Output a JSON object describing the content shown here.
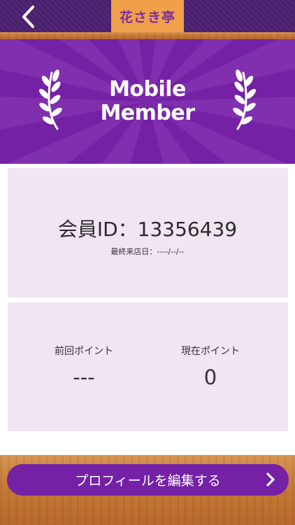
{
  "header": {
    "title": "花さき亭",
    "back_icon": "chevron-left-icon"
  },
  "banner": {
    "line1": "Mobile",
    "line2": "Member",
    "decoration_icon": "laurel-icon"
  },
  "member": {
    "id_text": "会員ID：13356439",
    "last_visit_text": "最終来店日：----/--/--"
  },
  "points": {
    "previous_label": "前回ポイント",
    "previous_value": "---",
    "current_label": "現在ポイント",
    "current_value": "0"
  },
  "footer": {
    "edit_profile_label": "プロフィールを編集する",
    "arrow_icon": "chevron-right-icon"
  },
  "colors": {
    "primary_purple": "#7421a6",
    "dark_purple": "#4a1f6d",
    "tab_orange": "#f0a04a",
    "card_bg": "#f1e4f3"
  }
}
